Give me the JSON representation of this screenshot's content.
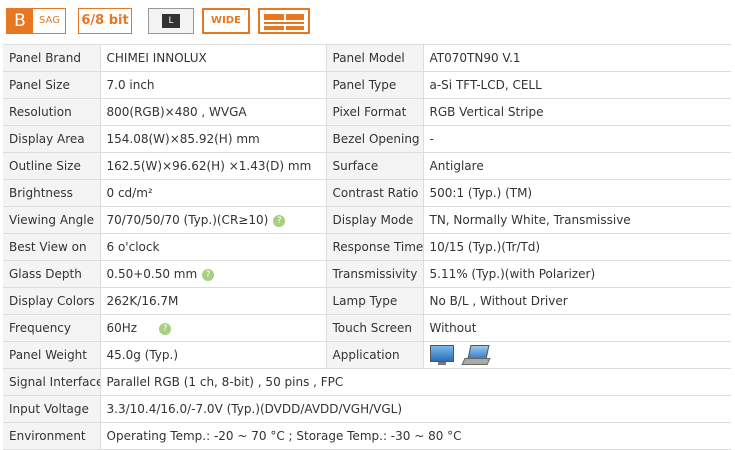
{
  "badges": {
    "sag_letter": "B",
    "sag_word": "SAG",
    "bit": "6/8 bit",
    "l_mark": "L",
    "wide": "WIDE"
  },
  "specs": [
    {
      "label": "Panel Brand",
      "value": "CHIMEI INNOLUX",
      "label2": "Panel Model",
      "value2": "AT070TN90 V.1"
    },
    {
      "label": "Panel Size",
      "value": "7.0 inch",
      "label2": "Panel Type",
      "value2": "a-Si TFT-LCD, CELL"
    },
    {
      "label": "Resolution",
      "value": "800(RGB)×480 , WVGA",
      "label2": "Pixel Format",
      "value2": "RGB Vertical Stripe"
    },
    {
      "label": "Display Area",
      "value": "154.08(W)×85.92(H) mm",
      "label2": "Bezel Opening",
      "value2": "-"
    },
    {
      "label": "Outline Size",
      "value": "162.5(W)×96.62(H) ×1.43(D) mm",
      "label2": "Surface",
      "value2": "Antiglare"
    },
    {
      "label": "Brightness",
      "value": "0 cd/m²",
      "label2": "Contrast Ratio",
      "value2": "500:1 (Typ.) (TM)"
    },
    {
      "label": "Viewing Angle",
      "value": "70/70/50/70 (Typ.)(CR≥10)",
      "label2": "Display Mode",
      "value2": "TN, Normally White, Transmissive"
    },
    {
      "label": "Best View on",
      "value": "6 o'clock",
      "label2": "Response Time",
      "value2": "10/15 (Typ.)(Tr/Td)"
    },
    {
      "label": "Glass Depth",
      "value": "0.50+0.50 mm",
      "label2": "Transmissivity",
      "value2": "5.11% (Typ.)(with Polarizer)"
    },
    {
      "label": "Display Colors",
      "value": "262K/16.7M",
      "label2": "Lamp Type",
      "value2": "No B/L , Without Driver"
    },
    {
      "label": "Frequency",
      "value": "60Hz",
      "label2": "Touch Screen",
      "value2": "Without"
    },
    {
      "label": "Panel Weight",
      "value": "45.0g (Typ.)",
      "label2": "Application",
      "value2": ""
    },
    {
      "label": "Signal Interface",
      "value": "Parallel RGB (1 ch, 8-bit) , 50 pins , FPC"
    },
    {
      "label": "Input Voltage",
      "value": "3.3/10.4/16.0/-7.0V (Typ.)(DVDD/AVDD/VGH/VGL)"
    },
    {
      "label": "Environment",
      "value": "Operating Temp.: -20 ~ 70 °C ; Storage Temp.: -30 ~ 80 °C"
    }
  ],
  "info_mark": "?",
  "colors": {
    "accent": "#e87722",
    "info": "#a8cf7f",
    "label_bg": "#f4f4f4",
    "border": "#dddddd"
  },
  "application_icons": [
    "monitor-icon",
    "laptop-icon"
  ]
}
